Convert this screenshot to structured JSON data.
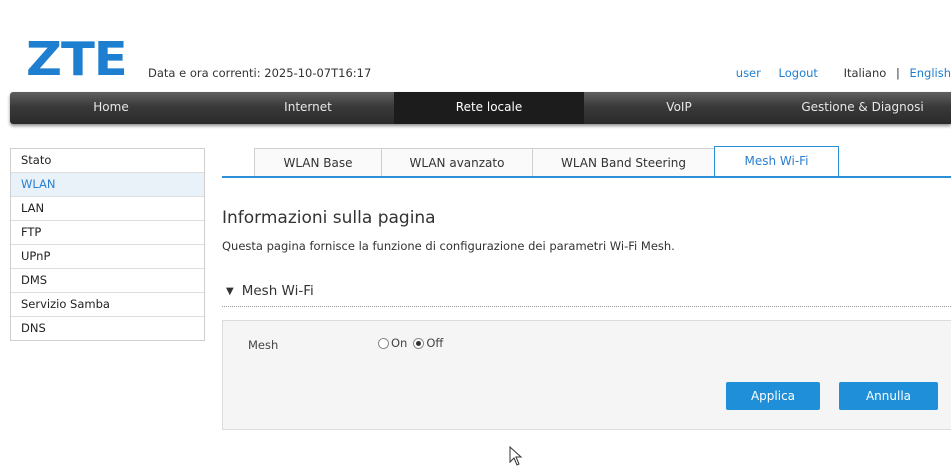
{
  "header": {
    "logo": "ZTE",
    "datetime_label": "Data e ora correnti:",
    "datetime_value": "2025-10-07T16:17",
    "user": "user",
    "logout": "Logout",
    "lang_italian": "Italiano",
    "lang_separator": "|",
    "lang_english": "English"
  },
  "nav": {
    "items": [
      {
        "label": "Home"
      },
      {
        "label": "Internet"
      },
      {
        "label": "Rete locale"
      },
      {
        "label": "VoIP"
      },
      {
        "label": "Gestione & Diagnosi"
      }
    ],
    "active_index": 2
  },
  "sidebar": {
    "items": [
      {
        "label": "Stato"
      },
      {
        "label": "WLAN"
      },
      {
        "label": "LAN"
      },
      {
        "label": "FTP"
      },
      {
        "label": "UPnP"
      },
      {
        "label": "DMS"
      },
      {
        "label": "Servizio Samba"
      },
      {
        "label": "DNS"
      }
    ],
    "active": "WLAN"
  },
  "tabs": {
    "items": [
      {
        "label": "WLAN Base"
      },
      {
        "label": "WLAN avanzato"
      },
      {
        "label": "WLAN Band Steering"
      },
      {
        "label": "Mesh Wi-Fi"
      }
    ],
    "active": "Mesh Wi-Fi"
  },
  "main": {
    "heading": "Informazioni sulla pagina",
    "description": "Questa pagina fornisce la funzione di configurazione dei parametri Wi-Fi Mesh.",
    "section_title": "Mesh Wi-Fi",
    "section_toggle_icon": "triangle-down-icon",
    "mesh_label": "Mesh",
    "radio_on": "On",
    "radio_off": "Off",
    "selected": "Off",
    "apply_label": "Applica",
    "cancel_label": "Annulla"
  },
  "colors": {
    "brand": "#1e7fd0",
    "accent": "#2a8fd6",
    "button": "#1e8fd8",
    "nav_bg": "#3a3a3a"
  }
}
